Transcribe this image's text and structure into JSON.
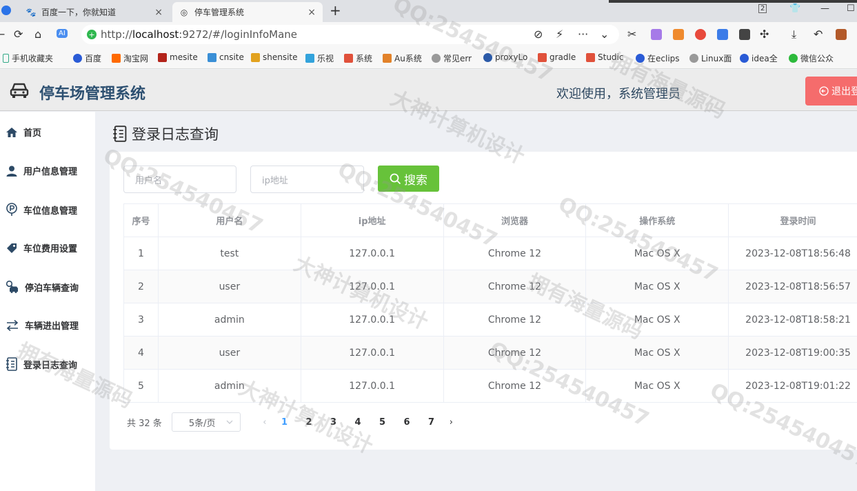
{
  "browser": {
    "tabs": [
      {
        "title": "百度一下，你就知道",
        "close": "×"
      },
      {
        "title": "停车管理系统",
        "close": "×"
      }
    ],
    "new_tab": "+",
    "window_controls": {
      "tab_count": "2",
      "minimize": "—",
      "maximize": "☐",
      "close": "✕"
    },
    "nav": {
      "back": "←",
      "reload": "⟳",
      "home": "⌂",
      "ai": "AI"
    },
    "url": {
      "prefix": "http://",
      "host": "localhost",
      "rest": ":9272/#/loginInfoMane"
    },
    "toolbar_glyphs": {
      "bolt": "⚡",
      "more": "···",
      "expand": "⌄"
    },
    "bookmarks": [
      "手机收藏夹",
      "百度",
      "淘宝网",
      "mesite",
      "cnsite",
      "shensite",
      "乐视",
      "系统",
      "Au系统",
      "常见err",
      "proxyLo",
      "gradle",
      "Studic",
      "在eclips",
      "Linux面",
      "idea全",
      "微信公众"
    ]
  },
  "header": {
    "title": "停车场管理系统",
    "welcome": "欢迎使用，系统管理员",
    "logout": "退出登"
  },
  "sidebar": {
    "items": [
      {
        "label": "首页",
        "icon": "home-icon"
      },
      {
        "label": "用户信息管理",
        "icon": "user-icon"
      },
      {
        "label": "车位信息管理",
        "icon": "parking-icon"
      },
      {
        "label": "车位费用设置",
        "icon": "price-tag-icon"
      },
      {
        "label": "停泊车辆查询",
        "icon": "car-search-icon"
      },
      {
        "label": "车辆进出管理",
        "icon": "transfer-icon"
      },
      {
        "label": "登录日志查询",
        "icon": "notebook-icon"
      }
    ]
  },
  "page": {
    "heading": "登录日志查询",
    "search": {
      "username_placeholder": "用户名",
      "ip_placeholder": "ip地址",
      "button": "搜索"
    },
    "table": {
      "columns": [
        "序号",
        "用户名",
        "ip地址",
        "浏览器",
        "操作系统",
        "登录时间"
      ],
      "rows": [
        [
          "1",
          "test",
          "127.0.0.1",
          "Chrome 12",
          "Mac OS X",
          "2023-12-08T18:56:48"
        ],
        [
          "2",
          "user",
          "127.0.0.1",
          "Chrome 12",
          "Mac OS X",
          "2023-12-08T18:56:57"
        ],
        [
          "3",
          "admin",
          "127.0.0.1",
          "Chrome 12",
          "Mac OS X",
          "2023-12-08T18:58:21"
        ],
        [
          "4",
          "user",
          "127.0.0.1",
          "Chrome 12",
          "Mac OS X",
          "2023-12-08T19:00:35"
        ],
        [
          "5",
          "admin",
          "127.0.0.1",
          "Chrome 12",
          "Mac OS X",
          "2023-12-08T19:01:22"
        ]
      ]
    },
    "pagination": {
      "total": "共 32 条",
      "page_size": "5条/页",
      "prev": "‹",
      "next": "›",
      "pages": [
        "1",
        "2",
        "3",
        "4",
        "5",
        "6",
        "7"
      ],
      "current": "1"
    }
  },
  "watermark": {
    "lines": [
      "QQ:254540457",
      "大神计算机设计",
      "拥有海量源码"
    ]
  },
  "colors": {
    "accent": "#409eff",
    "success": "#67c23a",
    "danger": "#f56c6c",
    "title": "#2d5071"
  }
}
